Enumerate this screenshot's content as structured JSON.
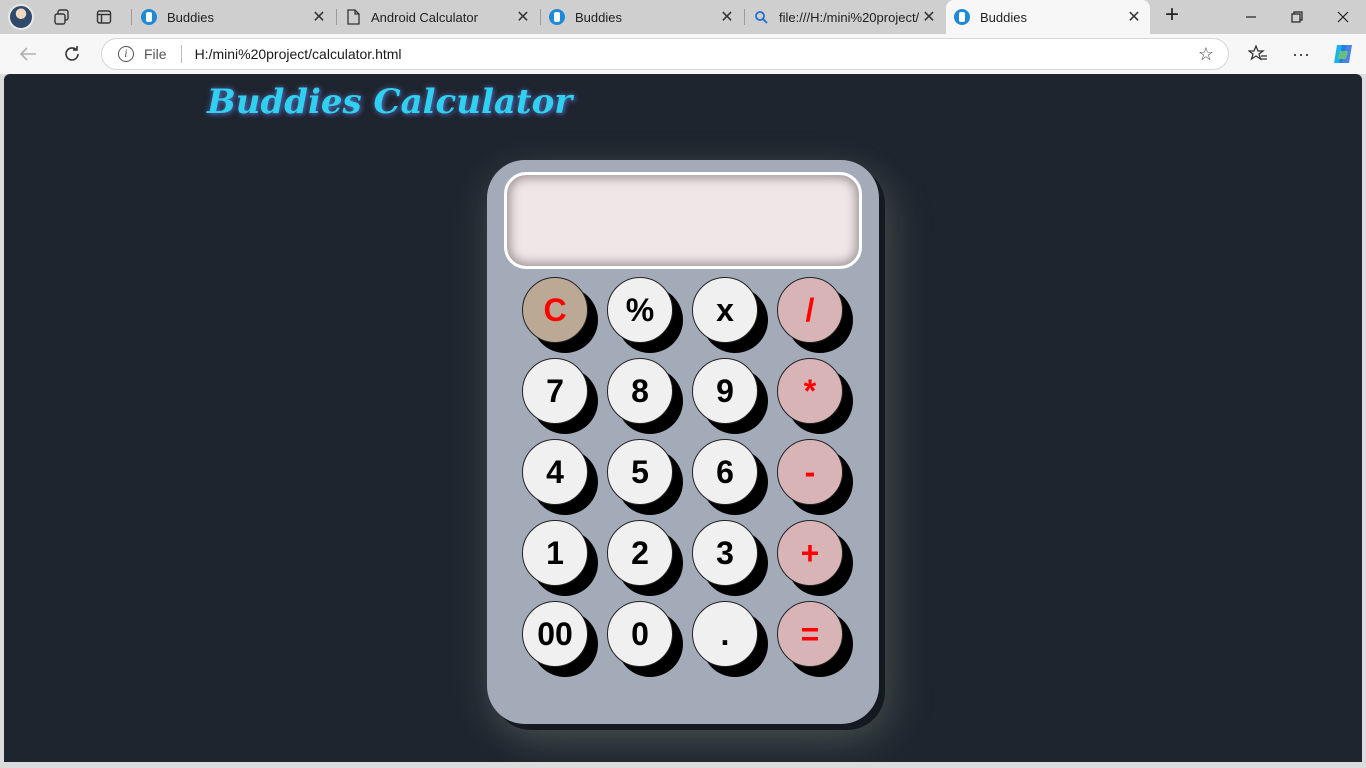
{
  "browser": {
    "tabs": [
      {
        "title": "Buddies",
        "icon": "buddies-favicon",
        "active": false
      },
      {
        "title": "Android Calculator",
        "icon": "page-icon",
        "active": false
      },
      {
        "title": "Buddies",
        "icon": "buddies-favicon",
        "active": false
      },
      {
        "title": "file:///H:/mini%20project/c",
        "icon": "search-icon",
        "active": false
      },
      {
        "title": "Buddies",
        "icon": "buddies-favicon",
        "active": true
      }
    ],
    "address": {
      "scheme_label": "File",
      "url": "H:/mini%20project/calculator.html"
    },
    "accent": "#1c8ad8"
  },
  "page": {
    "heading": "Buddies Calculator",
    "heading_color": "#2fd0f0",
    "background": "#1f252f",
    "display_value": ""
  },
  "calculator": {
    "keys": [
      [
        "C",
        "%",
        "x",
        "/"
      ],
      [
        "7",
        "8",
        "9",
        "*"
      ],
      [
        "4",
        "5",
        "6",
        "-"
      ],
      [
        "1",
        "2",
        "3",
        "+"
      ],
      [
        "00",
        "0",
        ".",
        "="
      ]
    ],
    "body_color": "#a3abb9",
    "operator_key_color": "#d9b4b6",
    "clear_key_color": "#bba995",
    "operator_text_color": "#ff0000"
  }
}
